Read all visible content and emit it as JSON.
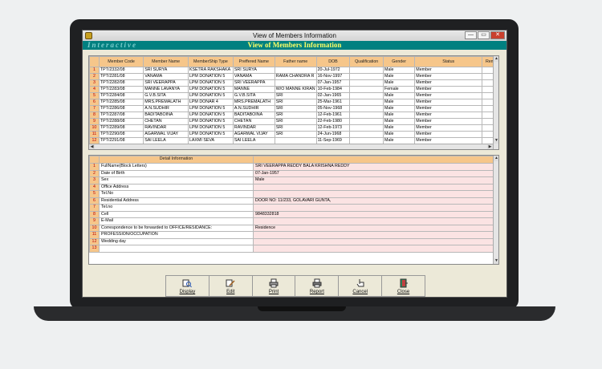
{
  "window": {
    "title": "View of Members Information",
    "min": "—",
    "max": "▭",
    "close": "✕"
  },
  "banner": {
    "left": "Interactive",
    "center": "View of Members Information"
  },
  "members": {
    "columns": [
      "Member Code",
      "Member Name",
      "MemberShip Type",
      "Preffered Name",
      "Father name",
      "DOB",
      "Qualification",
      "Gender",
      "Status",
      "Rem"
    ],
    "rows": [
      {
        "n": "1",
        "code": "TPT/2332/08",
        "name": "SRI SURYA",
        "type": "KSETRA RAKSHAKA",
        "pref": "SRI SURYA",
        "father": "",
        "dob": "20-Jul-1972",
        "qual": "",
        "gender": "Male",
        "status": "Member"
      },
      {
        "n": "2",
        "code": "TPT/2281/08",
        "name": "VANAMA",
        "type": "LPM DONATION 5",
        "pref": "VANAMA",
        "father": "RAMA CHANDRA R",
        "dob": "16-Nov-1997",
        "qual": "",
        "gender": "Male",
        "status": "Member"
      },
      {
        "n": "3",
        "code": "TPT/2282/08",
        "name": "SRI VEERAPPA",
        "type": "LPM DONATION 5",
        "pref": "SRI VEERAPPA",
        "father": "",
        "dob": "07-Jan-1957",
        "qual": "",
        "gender": "Male",
        "status": "Member"
      },
      {
        "n": "4",
        "code": "TPT/2283/08",
        "name": "MANNE LAVANYA",
        "type": "LPM DONATION 5",
        "pref": "MANNE",
        "father": "W/O MANNE KIRAN",
        "dob": "10-Feb-1984",
        "qual": "",
        "gender": "Female",
        "status": "Member"
      },
      {
        "n": "5",
        "code": "TPT/2284/08",
        "name": "G.V.B.SITA",
        "type": "LPM DONATION 5",
        "pref": "G.V.B.SITA",
        "father": "SRI",
        "dob": "02-Jan-1965",
        "qual": "",
        "gender": "Male",
        "status": "Member"
      },
      {
        "n": "6",
        "code": "TPT/2285/08",
        "name": "MRS.PREMALATH",
        "type": "LPM DONAR 4",
        "pref": "MRS.PREMALATH",
        "father": "SRI",
        "dob": "25-Mar-1961",
        "qual": "",
        "gender": "Male",
        "status": "Member"
      },
      {
        "n": "7",
        "code": "TPT/2286/08",
        "name": "A.N.SUDHIR",
        "type": "LPM DONATION 5",
        "pref": "A.N.SUDHIR",
        "father": "SRI",
        "dob": "05-Nov-1968",
        "qual": "",
        "gender": "Male",
        "status": "Member"
      },
      {
        "n": "8",
        "code": "TPT/2287/08",
        "name": "BADITABOINA",
        "type": "LPM DONATION 5",
        "pref": "BADITABOINA",
        "father": "SRI",
        "dob": "12-Feb-1961",
        "qual": "",
        "gender": "Male",
        "status": "Member"
      },
      {
        "n": "9",
        "code": "TPT/2288/08",
        "name": "CHETAN",
        "type": "LPM DONATION 5",
        "pref": "CHETAN",
        "father": "SRI",
        "dob": "22-Feb-1980",
        "qual": "",
        "gender": "Male",
        "status": "Member"
      },
      {
        "n": "10",
        "code": "TPT/2289/08",
        "name": "RAVINDAR",
        "type": "LPM DONATION 5",
        "pref": "RAVINDAR",
        "father": "SRI",
        "dob": "12-Feb-1973",
        "qual": "",
        "gender": "Male",
        "status": "Member"
      },
      {
        "n": "11",
        "code": "TPT/2290/08",
        "name": "AGARWAL VIJAY",
        "type": "LPM DONATION 5",
        "pref": "AGARWAL VIJAY",
        "father": "SRI",
        "dob": "24-Jun-1968",
        "qual": "",
        "gender": "Male",
        "status": "Member"
      },
      {
        "n": "12",
        "code": "TPT/2291/08",
        "name": "SAI LEELA",
        "type": "LAXMI SEVA",
        "pref": "SAI LEELA",
        "father": "",
        "dob": "11-Sep-1969",
        "qual": "",
        "gender": "Male",
        "status": "Member"
      }
    ]
  },
  "detail": {
    "header": "Detail Information",
    "rows": [
      {
        "n": "1",
        "label": "FullName(Block Letters)",
        "value": "SRI VEERAPPA REDDY BALA KRISHNA REDDY"
      },
      {
        "n": "2",
        "label": "Date of Birth",
        "value": "07-Jan-1957"
      },
      {
        "n": "3",
        "label": "Sex",
        "value": "Male"
      },
      {
        "n": "4",
        "label": "Office Address",
        "value": ""
      },
      {
        "n": "5",
        "label": " Tel.No",
        "value": ""
      },
      {
        "n": "6",
        "label": "Residential Address",
        "value": "DOOR NO: 11/233, GOLAVARI GUNTA,"
      },
      {
        "n": "7",
        "label": "Tel.no",
        "value": ""
      },
      {
        "n": "8",
        "label": "Cell",
        "value": "9848332818"
      },
      {
        "n": "9",
        "label": "E-Mail",
        "value": ""
      },
      {
        "n": "10",
        "label": "Correspondence to be forwarded to OFFICE/RESIDANCE:",
        "value": "Residence"
      },
      {
        "n": "11",
        "label": "PROFESSION/OCCUPATION",
        "value": ""
      },
      {
        "n": "12",
        "label": "Wedding day",
        "value": ""
      },
      {
        "n": "13",
        "label": "",
        "value": ""
      }
    ]
  },
  "toolbar": {
    "display": "Display",
    "edit": "Edit",
    "print": "Print",
    "report": "Report",
    "cancel": "Cancel",
    "close": "Close"
  },
  "colors": {
    "header_bg": "#f6c68a",
    "banner_bg": "#008080",
    "value_bg": "#fbe3e3"
  }
}
